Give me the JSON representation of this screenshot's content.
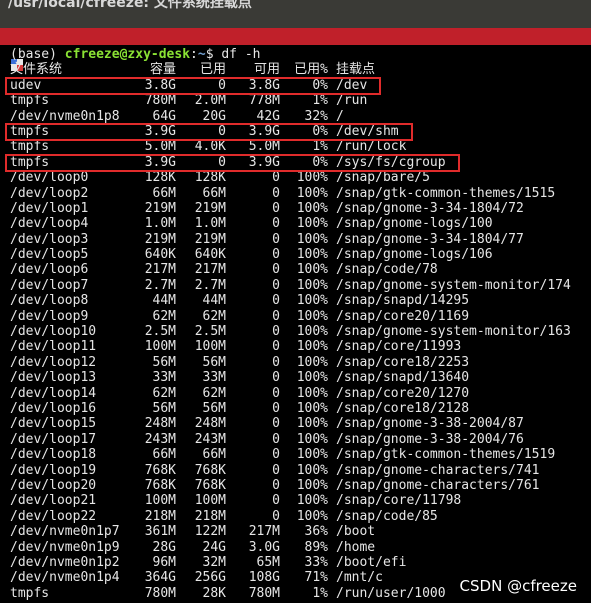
{
  "window": {
    "title": "/usr/local/cfreeze: 文件系统挂载点"
  },
  "prompt": {
    "env": "(base)",
    "user_host": "cfreeze@zxy-desk",
    "path": "~",
    "symbol": "$",
    "command": "df -h"
  },
  "columns": [
    "文件系统",
    "容量",
    "已用",
    "可用",
    "已用%",
    "挂载点"
  ],
  "rows": [
    [
      "udev",
      "3.8G",
      "0",
      "3.8G",
      "0%",
      "/dev"
    ],
    [
      "tmpfs",
      "780M",
      "2.0M",
      "778M",
      "1%",
      "/run"
    ],
    [
      "/dev/nvme0n1p8",
      "64G",
      "20G",
      "42G",
      "32%",
      "/"
    ],
    [
      "tmpfs",
      "3.9G",
      "0",
      "3.9G",
      "0%",
      "/dev/shm"
    ],
    [
      "tmpfs",
      "5.0M",
      "4.0K",
      "5.0M",
      "1%",
      "/run/lock"
    ],
    [
      "tmpfs",
      "3.9G",
      "0",
      "3.9G",
      "0%",
      "/sys/fs/cgroup"
    ],
    [
      "/dev/loop0",
      "128K",
      "128K",
      "0",
      "100%",
      "/snap/bare/5"
    ],
    [
      "/dev/loop2",
      "66M",
      "66M",
      "0",
      "100%",
      "/snap/gtk-common-themes/1515"
    ],
    [
      "/dev/loop1",
      "219M",
      "219M",
      "0",
      "100%",
      "/snap/gnome-3-34-1804/72"
    ],
    [
      "/dev/loop4",
      "1.0M",
      "1.0M",
      "0",
      "100%",
      "/snap/gnome-logs/100"
    ],
    [
      "/dev/loop3",
      "219M",
      "219M",
      "0",
      "100%",
      "/snap/gnome-3-34-1804/77"
    ],
    [
      "/dev/loop5",
      "640K",
      "640K",
      "0",
      "100%",
      "/snap/gnome-logs/106"
    ],
    [
      "/dev/loop6",
      "217M",
      "217M",
      "0",
      "100%",
      "/snap/code/78"
    ],
    [
      "/dev/loop7",
      "2.7M",
      "2.7M",
      "0",
      "100%",
      "/snap/gnome-system-monitor/174"
    ],
    [
      "/dev/loop8",
      "44M",
      "44M",
      "0",
      "100%",
      "/snap/snapd/14295"
    ],
    [
      "/dev/loop9",
      "62M",
      "62M",
      "0",
      "100%",
      "/snap/core20/1169"
    ],
    [
      "/dev/loop10",
      "2.5M",
      "2.5M",
      "0",
      "100%",
      "/snap/gnome-system-monitor/163"
    ],
    [
      "/dev/loop11",
      "100M",
      "100M",
      "0",
      "100%",
      "/snap/core/11993"
    ],
    [
      "/dev/loop12",
      "56M",
      "56M",
      "0",
      "100%",
      "/snap/core18/2253"
    ],
    [
      "/dev/loop13",
      "33M",
      "33M",
      "0",
      "100%",
      "/snap/snapd/13640"
    ],
    [
      "/dev/loop14",
      "62M",
      "62M",
      "0",
      "100%",
      "/snap/core20/1270"
    ],
    [
      "/dev/loop16",
      "56M",
      "56M",
      "0",
      "100%",
      "/snap/core18/2128"
    ],
    [
      "/dev/loop15",
      "248M",
      "248M",
      "0",
      "100%",
      "/snap/gnome-3-38-2004/87"
    ],
    [
      "/dev/loop17",
      "243M",
      "243M",
      "0",
      "100%",
      "/snap/gnome-3-38-2004/76"
    ],
    [
      "/dev/loop18",
      "66M",
      "66M",
      "0",
      "100%",
      "/snap/gtk-common-themes/1519"
    ],
    [
      "/dev/loop19",
      "768K",
      "768K",
      "0",
      "100%",
      "/snap/gnome-characters/741"
    ],
    [
      "/dev/loop20",
      "768K",
      "768K",
      "0",
      "100%",
      "/snap/gnome-characters/761"
    ],
    [
      "/dev/loop21",
      "100M",
      "100M",
      "0",
      "100%",
      "/snap/core/11798"
    ],
    [
      "/dev/loop22",
      "218M",
      "218M",
      "0",
      "100%",
      "/snap/code/85"
    ],
    [
      "/dev/nvme0n1p7",
      "361M",
      "122M",
      "217M",
      "36%",
      "/boot"
    ],
    [
      "/dev/nvme0n1p9",
      "28G",
      "24G",
      "3.0G",
      "89%",
      "/home"
    ],
    [
      "/dev/nvme0n1p2",
      "96M",
      "32M",
      "65M",
      "33%",
      "/boot/efi"
    ],
    [
      "/dev/nvme0n1p4",
      "364G",
      "256G",
      "108G",
      "71%",
      "/mnt/c"
    ],
    [
      "tmpfs",
      "780M",
      "28K",
      "780M",
      "1%",
      "/run/user/1000"
    ]
  ],
  "highlighted_rows": [
    0,
    3,
    5
  ],
  "watermark": "CSDN @cfreeze",
  "colors": {
    "background": "#000000",
    "text": "#e6e6e6",
    "prompt_user": "#8ae234",
    "prompt_path": "#729fcf",
    "highlight_box": "#e02b2b",
    "header_bar": "#c0202a"
  }
}
